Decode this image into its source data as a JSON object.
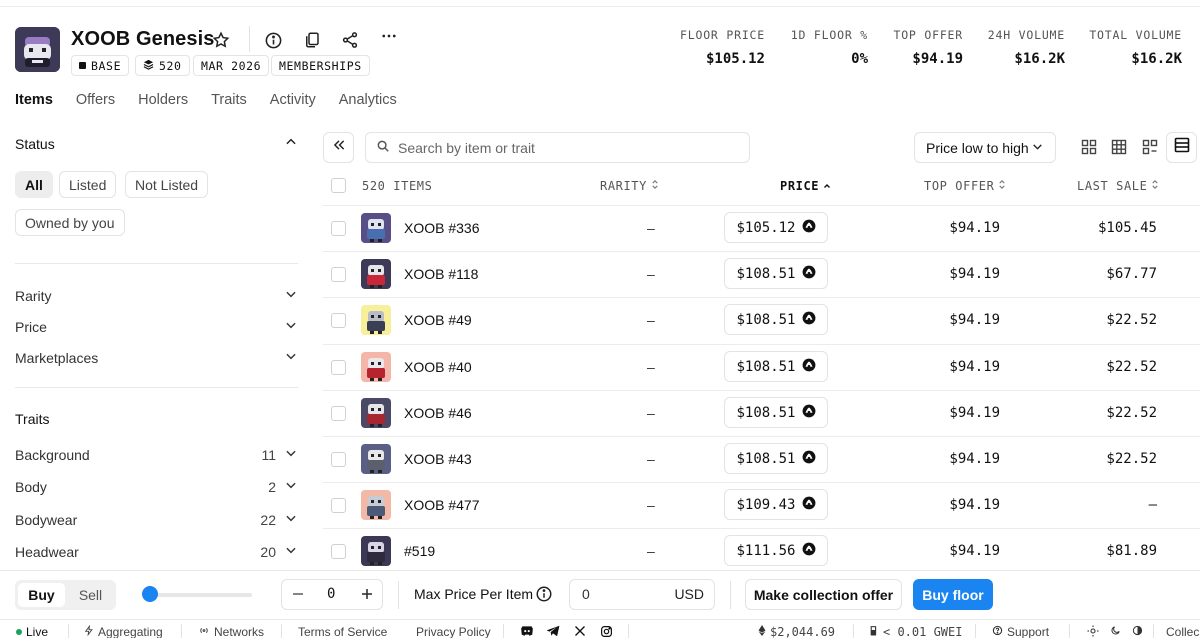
{
  "collection": {
    "name": "XOOB Genesis",
    "chips": [
      "BASE",
      "520",
      "MAR 2026",
      "MEMBERSHIPS"
    ]
  },
  "stats": [
    {
      "label": "FLOOR PRICE",
      "value": "$105.12"
    },
    {
      "label": "1D FLOOR %",
      "value": "0%"
    },
    {
      "label": "TOP OFFER",
      "value": "$94.19"
    },
    {
      "label": "24H VOLUME",
      "value": "$16.2K"
    },
    {
      "label": "TOTAL VOLUME",
      "value": "$16.2K"
    }
  ],
  "tabs": [
    "Items",
    "Offers",
    "Holders",
    "Traits",
    "Activity",
    "Analytics"
  ],
  "sidebar": {
    "status_title": "Status",
    "status_options": [
      "All",
      "Listed",
      "Not Listed",
      "Owned by you"
    ],
    "filters": [
      "Rarity",
      "Price",
      "Marketplaces"
    ],
    "traits_title": "Traits",
    "traits": [
      {
        "label": "Background",
        "count": "11"
      },
      {
        "label": "Body",
        "count": "2"
      },
      {
        "label": "Bodywear",
        "count": "22"
      },
      {
        "label": "Headwear",
        "count": "20"
      }
    ]
  },
  "toolbar": {
    "search_placeholder": "Search by item or trait",
    "sort_label": "Price low to high"
  },
  "table": {
    "headers": {
      "items": "520 ITEMS",
      "rarity": "RARITY",
      "price": "PRICE",
      "top_offer": "TOP OFFER",
      "last_sale": "LAST SALE"
    },
    "rows": [
      {
        "name": "XOOB #336",
        "rarity": "–",
        "price": "$105.12",
        "top_offer": "$94.19",
        "last_sale": "$105.45",
        "bg": "#5a4e86",
        "body": "#dfe3ef",
        "wear": "#4a6fb0"
      },
      {
        "name": "XOOB #118",
        "rarity": "–",
        "price": "$108.51",
        "top_offer": "$94.19",
        "last_sale": "$67.77",
        "bg": "#3d3a57",
        "body": "#e6e6ea",
        "wear": "#c8283a"
      },
      {
        "name": "XOOB #49",
        "rarity": "–",
        "price": "$108.51",
        "top_offer": "$94.19",
        "last_sale": "$22.52",
        "bg": "#f7ef9a",
        "body": "#b9bcc7",
        "wear": "#3b3f55"
      },
      {
        "name": "XOOB #40",
        "rarity": "–",
        "price": "$108.51",
        "top_offer": "$94.19",
        "last_sale": "$22.52",
        "bg": "#f4b6a8",
        "body": "#e9e7ea",
        "wear": "#b7242e"
      },
      {
        "name": "XOOB #46",
        "rarity": "–",
        "price": "$108.51",
        "top_offer": "$94.19",
        "last_sale": "$22.52",
        "bg": "#4b4a66",
        "body": "#e5e4ea",
        "wear": "#a82630"
      },
      {
        "name": "XOOB #43",
        "rarity": "–",
        "price": "$108.51",
        "top_offer": "$94.19",
        "last_sale": "$22.52",
        "bg": "#5a5f86",
        "body": "#e7e7ea",
        "wear": "#5b5f6e"
      },
      {
        "name": "XOOB #477",
        "rarity": "–",
        "price": "$109.43",
        "top_offer": "$94.19",
        "last_sale": "–",
        "bg": "#f2b9a8",
        "body": "#c7cbd6",
        "wear": "#4c5a78"
      },
      {
        "name": "#519",
        "rarity": "–",
        "price": "$111.56",
        "top_offer": "$94.19",
        "last_sale": "$81.89",
        "bg": "#3b3856",
        "body": "#d9d5e6",
        "wear": "#2c2a3c"
      }
    ]
  },
  "bottom": {
    "buy": "Buy",
    "sell": "Sell",
    "quantity": "0",
    "max_price_label": "Max Price Per Item",
    "max_price_value": "0",
    "currency": "USD",
    "make_offer": "Make collection offer",
    "buy_floor": "Buy floor"
  },
  "footer": {
    "live": "Live",
    "aggregating": "Aggregating",
    "networks": "Networks",
    "terms": "Terms of Service",
    "privacy": "Privacy Policy",
    "eth_price": "$2,044.69",
    "gas": "< 0.01 GWEI",
    "support": "Support",
    "collection_cut": "Collec"
  },
  "colors": {
    "accent": "#1a84f0",
    "live_dot": "#19a35b"
  }
}
